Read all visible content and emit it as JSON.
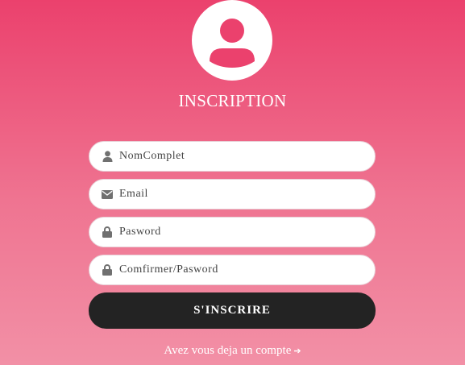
{
  "form": {
    "title": "INSCRIPTION",
    "fields": [
      {
        "placeholder": "NomComplet",
        "icon": "user-icon"
      },
      {
        "placeholder": "Email",
        "icon": "envelope-icon"
      },
      {
        "placeholder": "Pasword",
        "icon": "lock-icon"
      },
      {
        "placeholder": "Comfirmer/Pasword",
        "icon": "lock-icon"
      }
    ],
    "submit_label": "S'INSCRIRE",
    "login_link": "Avez vous deja un compte",
    "login_arrow": "➔"
  },
  "colors": {
    "gradient_top": "#eb416d",
    "gradient_bottom": "#f290a6",
    "button": "#232323",
    "icon": "#707070"
  }
}
